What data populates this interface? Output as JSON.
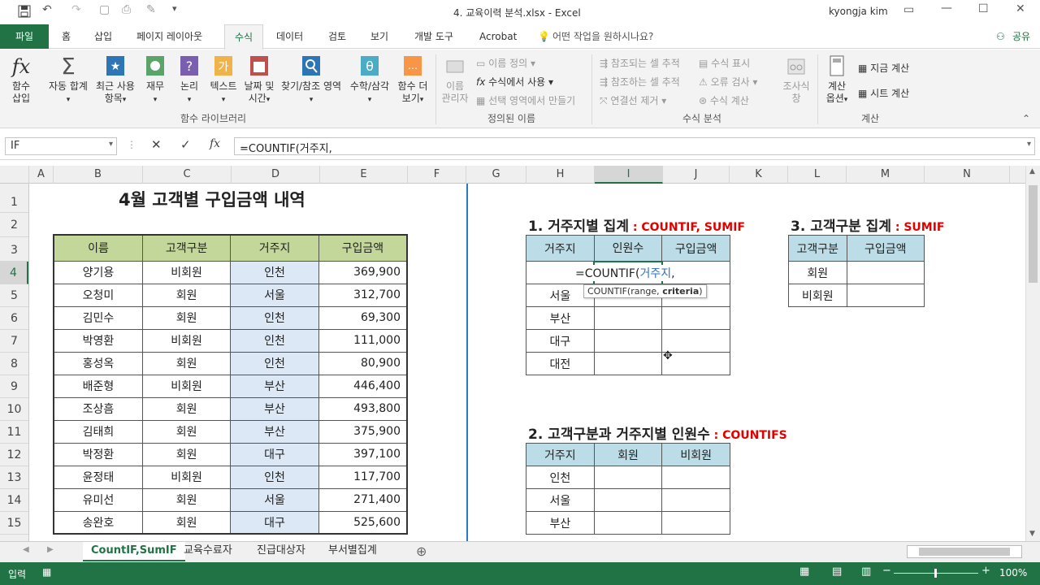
{
  "app": {
    "window_title": "4. 교육이력 분석.xlsx  -  Excel",
    "user": "kyongja kim"
  },
  "tabs": {
    "file": "파일",
    "items": [
      "홈",
      "삽입",
      "페이지 레이아웃",
      "수식",
      "데이터",
      "검토",
      "보기",
      "개발 도구",
      "Acrobat"
    ],
    "active": "수식",
    "tell_me": "어떤 작업을 원하시나요?",
    "share": "공유"
  },
  "ribbon": {
    "insert_function": [
      "함수",
      "삽입"
    ],
    "autosum": [
      "자동 합계"
    ],
    "recent": [
      "최근 사용",
      "항목"
    ],
    "financial": [
      "재무"
    ],
    "logical": [
      "논리"
    ],
    "text": [
      "텍스트"
    ],
    "datetime": [
      "날짜 및",
      "시간"
    ],
    "lookup": [
      "찾기/참조 영역"
    ],
    "math": [
      "수학/삼각"
    ],
    "more": [
      "함수 더",
      "보기"
    ],
    "group_library": "함수 라이브러리",
    "name_manager": [
      "이름",
      "관리자"
    ],
    "define_name": "이름 정의",
    "use_in_formula": "수식에서 사용",
    "create_from_selection": "선택 영역에서 만들기",
    "group_defined": "정의된 이름",
    "trace_precedents": "참조되는 셀 추적",
    "trace_dependents": "참조하는 셀 추적",
    "remove_arrows": "연결선 제거",
    "show_formulas": "수식 표시",
    "error_checking": "오류 검사",
    "evaluate_formula": "수식 계산",
    "watch_window": [
      "조사식",
      "창"
    ],
    "group_auditing": "수식 분석",
    "calc_options": [
      "계산",
      "옵션"
    ],
    "calc_now": "지금 계산",
    "calc_sheet": "시트 계산",
    "group_calc": "계산"
  },
  "formula_bar": {
    "name_box": "IF",
    "formula": "=COUNTIF(거주지,"
  },
  "columns": [
    "A",
    "B",
    "C",
    "D",
    "E",
    "F",
    "G",
    "H",
    "I",
    "J",
    "K",
    "L",
    "M",
    "N",
    "O"
  ],
  "rows": [
    "1",
    "2",
    "3",
    "4",
    "5",
    "6",
    "7",
    "8",
    "9",
    "10",
    "11",
    "12",
    "13",
    "14",
    "15"
  ],
  "sheet": {
    "title": "4월 고객별 구입금액 내역",
    "table_headers": [
      "이름",
      "고객구분",
      "거주지",
      "구입금액"
    ],
    "table_rows": [
      [
        "양기용",
        "비회원",
        "인천",
        "369,900"
      ],
      [
        "오청미",
        "회원",
        "서울",
        "312,700"
      ],
      [
        "김민수",
        "회원",
        "인천",
        "69,300"
      ],
      [
        "박영환",
        "비회원",
        "인천",
        "111,000"
      ],
      [
        "홍성옥",
        "회원",
        "인천",
        "80,900"
      ],
      [
        "배준형",
        "비회원",
        "부산",
        "446,400"
      ],
      [
        "조상흠",
        "회원",
        "부산",
        "493,800"
      ],
      [
        "김태희",
        "회원",
        "부산",
        "375,900"
      ],
      [
        "박정환",
        "회원",
        "대구",
        "397,100"
      ],
      [
        "윤정태",
        "비회원",
        "인천",
        "117,700"
      ],
      [
        "유미선",
        "회원",
        "서울",
        "271,400"
      ],
      [
        "송완호",
        "회원",
        "대구",
        "525,600"
      ]
    ],
    "sec1_title": "1. 거주지별 집계",
    "sec1_fn": " : COUNTIF, SUMIF",
    "sec1_headers": [
      "거주지",
      "인원수",
      "구입금액"
    ],
    "sec1_rows": [
      "인천",
      "서울",
      "부산",
      "대구",
      "대전"
    ],
    "editing_formula_prefix": "=COUNTIF(",
    "editing_formula_ref": "거주지",
    "editing_formula_suffix": ",",
    "tooltip": "COUNTIF(range, ",
    "tooltip_bold": "criteria",
    "tooltip_end": ")",
    "sec2_title": "2. 고객구분과 거주지별 인원수",
    "sec2_fn": " : COUNTIFS",
    "sec2_headers": [
      "거주지",
      "회원",
      "비회원"
    ],
    "sec2_rows": [
      "인천",
      "서울",
      "부산"
    ],
    "sec3_title": "3. 고객구분 집계",
    "sec3_fn": " : SUMIF",
    "sec3_headers": [
      "고객구분",
      "구입금액"
    ],
    "sec3_rows": [
      "회원",
      "비회원"
    ]
  },
  "sheet_tabs": [
    "CountIF,SumIF",
    "교육수료자",
    "진급대상자",
    "부서별집계"
  ],
  "status": {
    "mode": "입력",
    "zoom": "100%"
  }
}
